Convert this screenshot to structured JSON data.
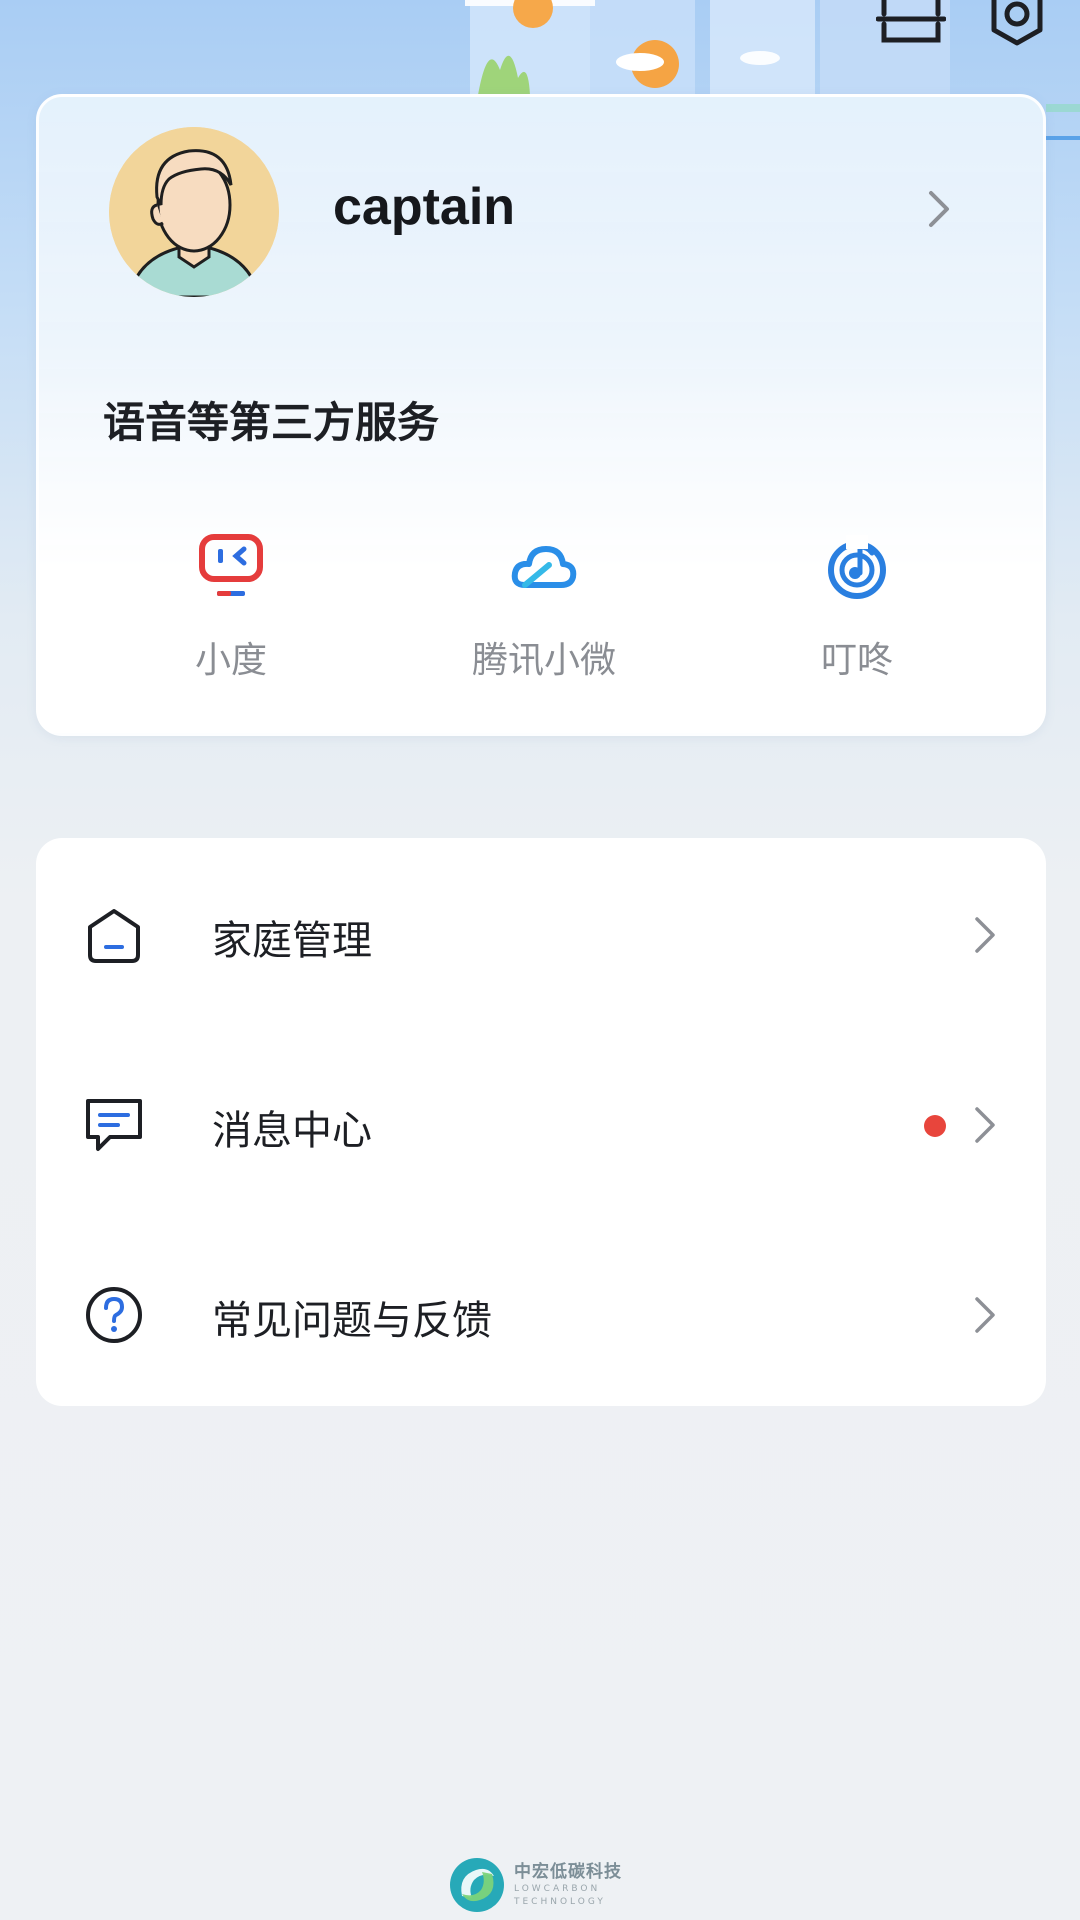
{
  "profile": {
    "username": "captain"
  },
  "services": {
    "title": "语音等第三方服务",
    "items": [
      {
        "label": "小度",
        "icon": "xiaodu-robot-icon"
      },
      {
        "label": "腾讯小微",
        "icon": "tencent-cloud-icon"
      },
      {
        "label": "叮咚",
        "icon": "dingdong-music-icon"
      }
    ]
  },
  "menu": {
    "items": [
      {
        "label": "家庭管理",
        "icon": "home-icon",
        "has_badge": false
      },
      {
        "label": "消息中心",
        "icon": "message-icon",
        "has_badge": true
      },
      {
        "label": "常见问题与反馈",
        "icon": "help-icon",
        "has_badge": false
      }
    ]
  },
  "footer": {
    "brand_cn": "中宏低碳科技",
    "brand_en_line1": "LOWCARBON",
    "brand_en_line2": "TECHNOLOGY"
  },
  "colors": {
    "badge": "#e8453c",
    "service_label": "#8a8d93",
    "accent_blue": "#2a8ee8"
  }
}
